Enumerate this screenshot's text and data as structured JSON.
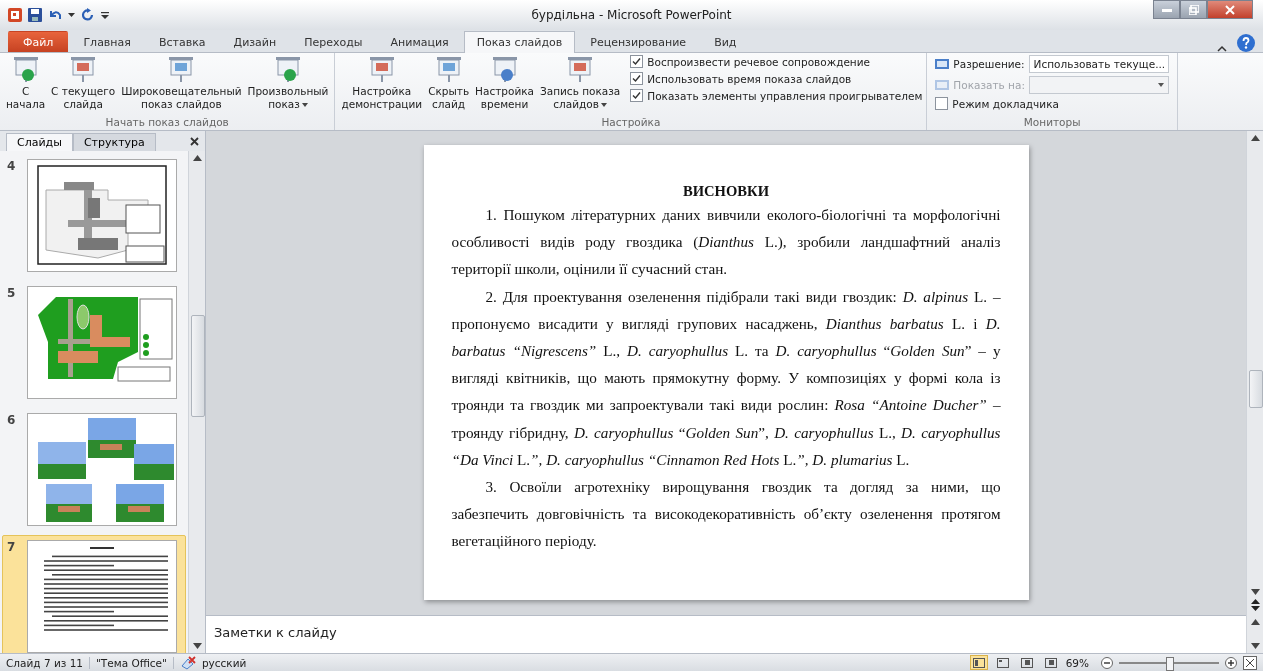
{
  "window": {
    "title": "бурдільна - Microsoft PowerPoint"
  },
  "ribbon_tabs": [
    {
      "label": "Файл",
      "kind": "file",
      "selected": false
    },
    {
      "label": "Главная",
      "kind": "tab",
      "selected": false
    },
    {
      "label": "Вставка",
      "kind": "tab",
      "selected": false
    },
    {
      "label": "Дизайн",
      "kind": "tab",
      "selected": false
    },
    {
      "label": "Переходы",
      "kind": "tab",
      "selected": false
    },
    {
      "label": "Анимация",
      "kind": "tab",
      "selected": false
    },
    {
      "label": "Показ слайдов",
      "kind": "tab",
      "selected": true
    },
    {
      "label": "Рецензирование",
      "kind": "tab",
      "selected": false
    },
    {
      "label": "Вид",
      "kind": "tab",
      "selected": false
    }
  ],
  "ribbon_groups": [
    {
      "label": "Начать показ слайдов",
      "buttons": [
        {
          "lines": [
            "С",
            "начала"
          ],
          "dropdown": false
        },
        {
          "lines": [
            "С текущего",
            "слайда"
          ],
          "dropdown": false
        },
        {
          "lines": [
            "Широковещательный",
            "показ слайдов"
          ],
          "dropdown": false
        },
        {
          "lines": [
            "Произвольный",
            "показ"
          ],
          "dropdown": true
        }
      ]
    },
    {
      "label": "Настройка",
      "buttons": [
        {
          "lines": [
            "Настройка",
            "демонстрации"
          ],
          "dropdown": false
        },
        {
          "lines": [
            "Скрыть",
            "слайд"
          ],
          "dropdown": false
        },
        {
          "lines": [
            "Настройка",
            "времени"
          ],
          "dropdown": false
        },
        {
          "lines": [
            "Запись показа",
            "слайдов"
          ],
          "dropdown": true
        }
      ],
      "checks": [
        {
          "label": "Воспроизвести речевое сопровождение",
          "checked": true
        },
        {
          "label": "Использовать время показа слайдов",
          "checked": true
        },
        {
          "label": "Показать элементы управления проигрывателем",
          "checked": true
        }
      ]
    }
  ],
  "monitors": {
    "label": "Мониторы",
    "fields": [
      {
        "label": "Разрешение:",
        "value": "Использовать текуще...",
        "disabled": false
      },
      {
        "label": "Показать на:",
        "disabled": true
      }
    ],
    "checkbox": {
      "label": "Режим докладчика",
      "checked": false
    }
  },
  "panel_tabs": [
    {
      "label": "Слайды",
      "selected": true
    },
    {
      "label": "Структура",
      "selected": false
    }
  ],
  "slides": [
    {
      "number": "4",
      "kind": "plan",
      "selected": false
    },
    {
      "number": "5",
      "kind": "green-plan",
      "selected": false
    },
    {
      "number": "6",
      "kind": "pictures",
      "selected": false
    },
    {
      "number": "7",
      "kind": "text",
      "selected": true
    }
  ],
  "slide": {
    "title": "ВИСНОВКИ",
    "paragraphs": [
      "1. Пошуком літературних даних вивчили еколого-біологічні та морфологічні особливості видів роду гвоздика (*Dianthus* L.), зробили ландшафтний аналіз території школи, оцінили її сучасний стан.",
      "2. Для проектування озеленення підібрали такі види гвоздик: *D. alpinus* L. – пропонуємо висадити у вигляді групових насаджень, *Dianthus barbatus* L. і *D. barbatus “Nigrescens”* L., *D. caryophullus* L. та *D. caryophullus* “*Golden Sun*” – у вигляді квітників, що мають прямокутну форму. У композиціях у формі кола із троянди та гвоздик ми запроектували такі види рослин: *Rosa “Antoine Ducher”* – троянду гібридну, *D. caryophullus* “*Golden Sun*”, *D. caryophullus* L., *D. caryophullus* *“Da Vinci* L.*”, D. caryophullus* *“Cinnamon Red Hots* L.*”, D. plumarius* L.",
      "3. Освоїли агротехніку вирощування гвоздик та догляд за ними, що забезпечить довговічність та високодекоративність об’єкту озеленення протягом вегетаційного періоду."
    ]
  },
  "notes": {
    "placeholder": "Заметки к слайду"
  },
  "status_bar": {
    "slide": "Слайд 7 из 11",
    "theme": "\"Тема Office\"",
    "language": "русский",
    "views": [
      {
        "selected": true
      },
      {
        "selected": false
      },
      {
        "selected": false
      },
      {
        "selected": false
      }
    ],
    "zoom": "69%",
    "zoom_slider": {
      "level": 0.5
    }
  }
}
